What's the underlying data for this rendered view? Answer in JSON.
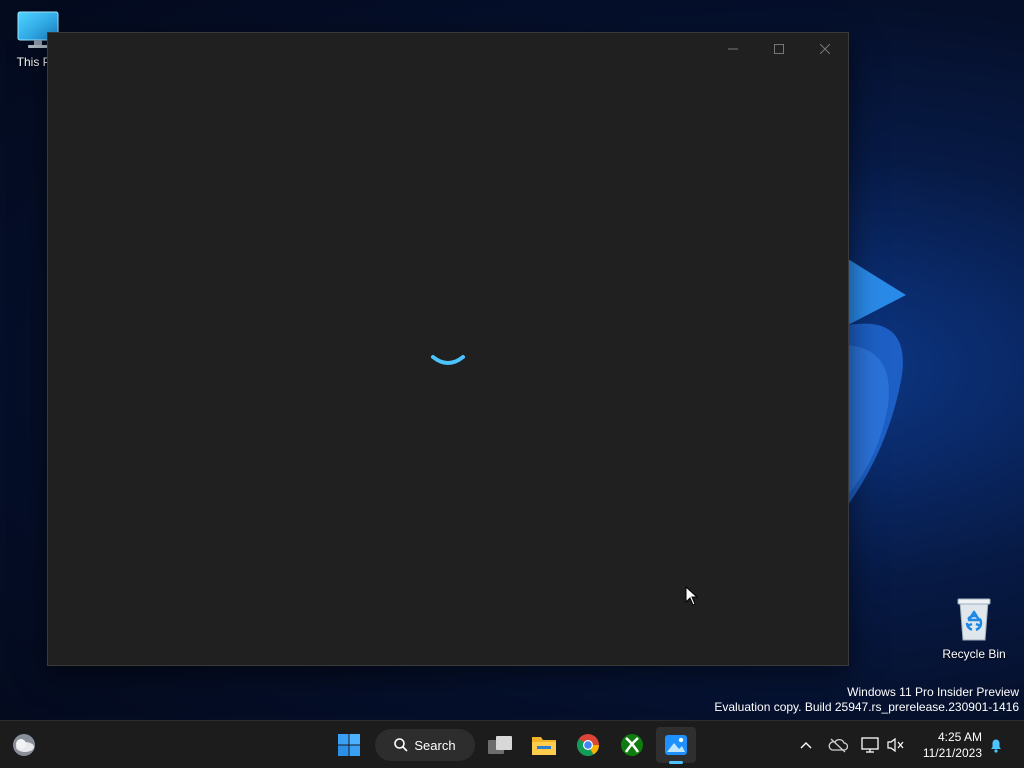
{
  "desktop": {
    "icons": [
      {
        "label": "This PC",
        "icon": "monitor-icon"
      },
      {
        "label": "Recycle Bin",
        "icon": "recycle-bin-icon"
      }
    ]
  },
  "window": {
    "title": "",
    "state": "loading",
    "spinner_color": "#4cc2ff",
    "background": "#202020"
  },
  "watermark": {
    "line1": "Windows 11 Pro Insider Preview",
    "line2": "Evaluation copy. Build 25947.rs_prerelease.230901-1416"
  },
  "taskbar": {
    "search_label": "Search",
    "apps": [
      "weather-icon",
      "start-icon",
      "task-view-icon",
      "file-explorer-icon",
      "chrome-icon",
      "xbox-icon",
      "photos-icon"
    ],
    "active_app": "photos-icon",
    "accent": "#4cc2ff"
  },
  "tray": {
    "time": "4:25 AM",
    "date": "11/21/2023"
  }
}
